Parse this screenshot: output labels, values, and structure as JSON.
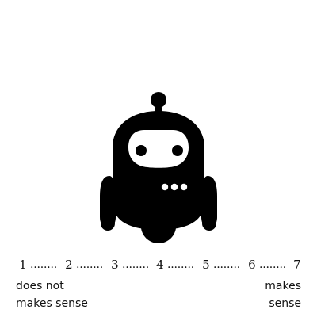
{
  "icon": "robot-icon",
  "scale": {
    "numbers": [
      "1",
      "2",
      "3",
      "4",
      "5",
      "6",
      "7"
    ],
    "dots": "........"
  },
  "labels": {
    "left": {
      "line1": "does not",
      "line2": "makes sense"
    },
    "right": {
      "line1": "makes",
      "line2": "sense"
    }
  },
  "colors": {
    "foreground": "#111111",
    "background": "#ffffff"
  }
}
